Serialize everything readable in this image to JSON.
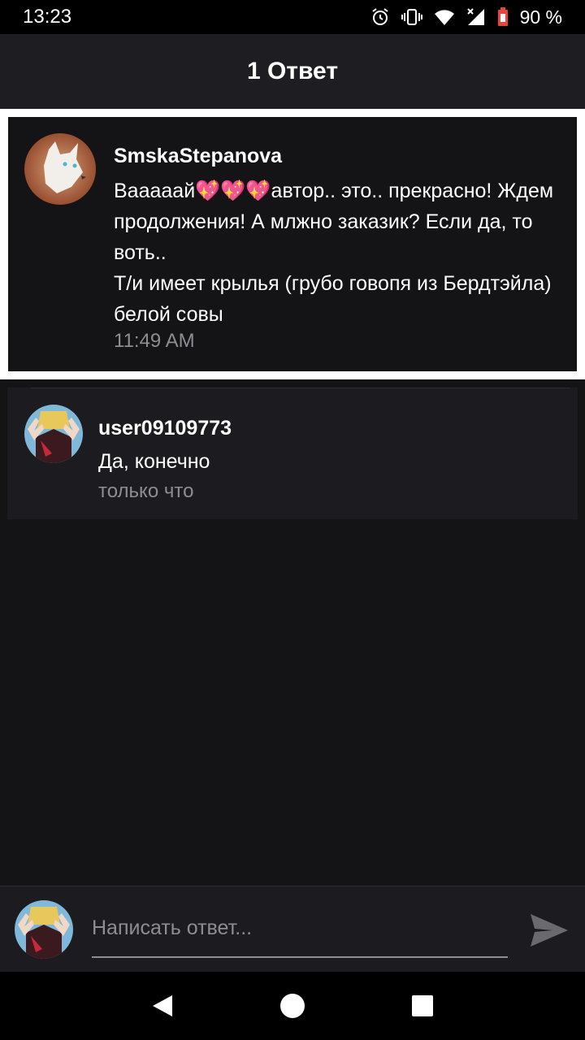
{
  "status_bar": {
    "time": "13:23",
    "battery": "90 %"
  },
  "app_bar": {
    "title": "1 Ответ"
  },
  "root_comment": {
    "author": "SmskaStepanova",
    "text_line1": "Вааааай💖💖💖автор.. это.. прекрасно! Ждем",
    "text_line2": "продолжения! А млжно заказик? Если да, то",
    "text_line3": "воть..",
    "text_line4": "Т/и имеет крылья (грубо говопя из Бердтэйла)",
    "text_line5": "белой совы",
    "time": "11:49 AM"
  },
  "reply": {
    "author": "user09109773",
    "text": "Да, конечно",
    "time": "только что"
  },
  "composer": {
    "placeholder": "Написать ответ..."
  },
  "colors": {
    "background": "#141316",
    "card": "#1c1b1f",
    "muted": "#8e8d92"
  },
  "icons": [
    "alarm-icon",
    "vibrate-icon",
    "wifi-icon",
    "signal-icon",
    "battery-icon",
    "send-icon",
    "back-icon",
    "home-icon",
    "recents-icon"
  ]
}
